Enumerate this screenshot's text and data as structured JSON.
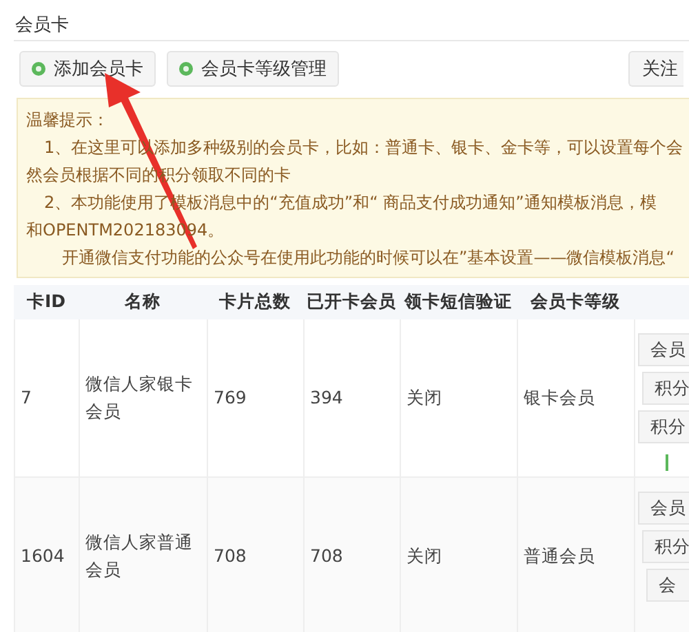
{
  "page_title": "会员卡",
  "toolbar": {
    "buttons": [
      {
        "label": "添加会员卡"
      },
      {
        "label": "会员卡等级管理"
      }
    ],
    "right_button": "关注"
  },
  "notice": {
    "lines": [
      {
        "text": "温馨提示：",
        "kind": "heading"
      },
      {
        "text": "1、在这里可以添加多种级别的会员卡，比如：普通卡、银卡、金卡等，可以设置每个会",
        "kind": "item"
      },
      {
        "text": "然会员根据不同的积分领取不同的卡",
        "kind": "continuation"
      },
      {
        "text": "2、本功能使用了模板消息中的“充值成功”和“ 商品支付成功通知”通知模板消息，模",
        "kind": "item"
      },
      {
        "text": "和OPENTM202183094。",
        "kind": "continuation"
      },
      {
        "text": "开通微信支付功能的公众号在使用此功能的时候可以在”基本设置——微信模板消息“",
        "kind": "paragraph"
      }
    ]
  },
  "table": {
    "columns": [
      "卡ID",
      "名称",
      "卡片总数",
      "已开卡会员",
      "领卡短信验证",
      "会员卡等级"
    ],
    "rows": [
      {
        "cells": [
          "7",
          "微信人家银卡会员",
          "769",
          "394",
          "关闭",
          "银卡会员"
        ],
        "actions": [
          {
            "kind": "button",
            "label": "会员"
          },
          {
            "kind": "button",
            "label": "积分"
          },
          {
            "kind": "button",
            "label": "积分"
          },
          {
            "kind": "mark"
          }
        ]
      },
      {
        "cells": [
          "1604",
          "微信人家普通会员",
          "708",
          "708",
          "关闭",
          "普通会员"
        ],
        "actions": [
          {
            "kind": "button",
            "label": "会员"
          },
          {
            "kind": "button",
            "label": "积分"
          },
          {
            "kind": "button",
            "label": "会"
          }
        ]
      }
    ]
  },
  "annotation": {
    "kind": "arrow"
  }
}
